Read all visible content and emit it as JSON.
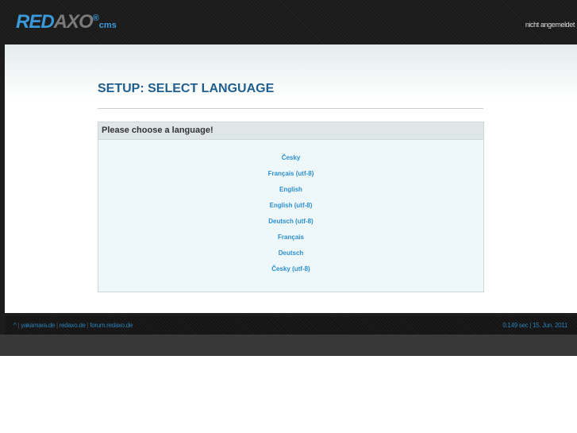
{
  "header": {
    "logo": {
      "main": "RED",
      "grey": "AXO",
      "sup": "®",
      "cms": "cms"
    },
    "login_status": "nicht angemeldet"
  },
  "main": {
    "title": "SETUP: SELECT LANGUAGE",
    "box_title": "Please choose a language!",
    "languages": [
      "Česky",
      "Français (utf-8)",
      "English",
      "English (utf-8)",
      "Deutsch (utf-8)",
      "Français",
      "Deutsch",
      "Česky (utf-8)"
    ]
  },
  "footer": {
    "top_link": "^",
    "links": [
      "yakamara.de",
      "redaxo.de",
      "forum.redaxo.de"
    ],
    "separator": "|",
    "time": "0.149 sec",
    "date": "15. Jun. 2011"
  }
}
